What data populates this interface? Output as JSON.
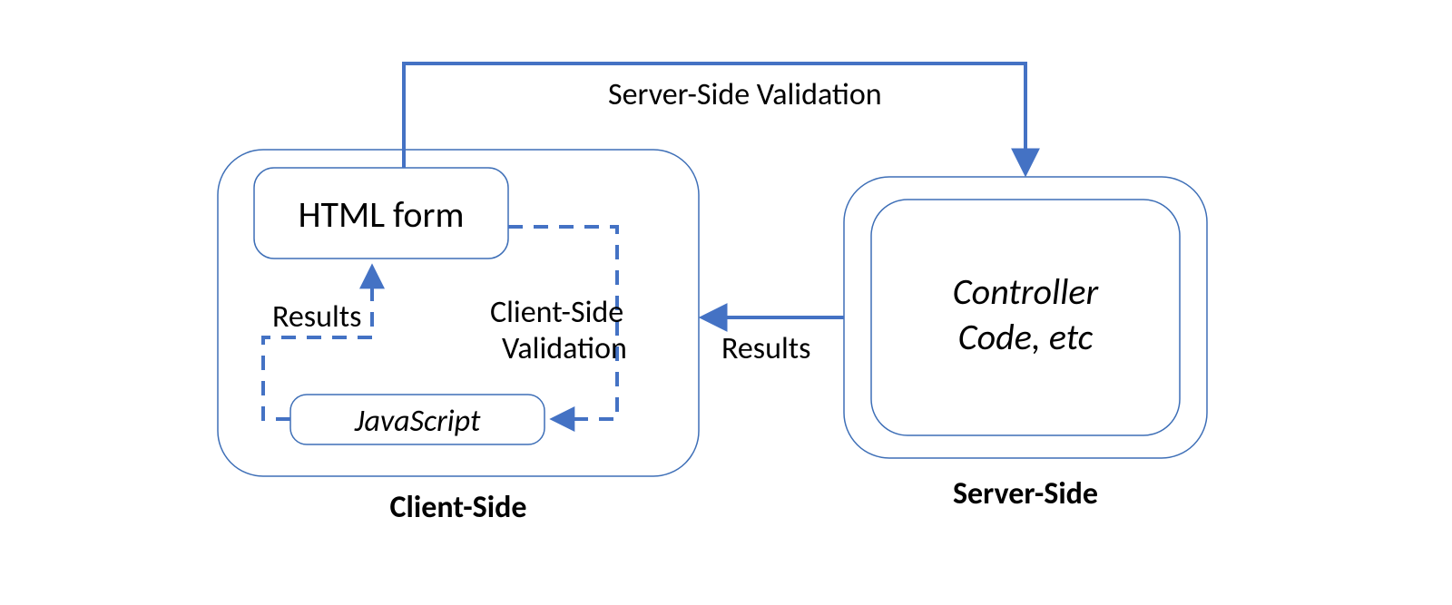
{
  "nodes": {
    "client_side_title": "Client-Side",
    "server_side_title": "Server-Side",
    "html_form": "HTML form",
    "javascript": "JavaScript",
    "controller_line1": "Controller",
    "controller_line2": "Code, etc"
  },
  "edges": {
    "server_side_validation": "Server-Side Validation",
    "client_side_validation_line1": "Client-Side",
    "client_side_validation_line2": "Validation",
    "results_left": "Results",
    "results_right": "Results"
  },
  "colors": {
    "blue": "#4472C4",
    "thin_blue": "#3E6FB7"
  }
}
